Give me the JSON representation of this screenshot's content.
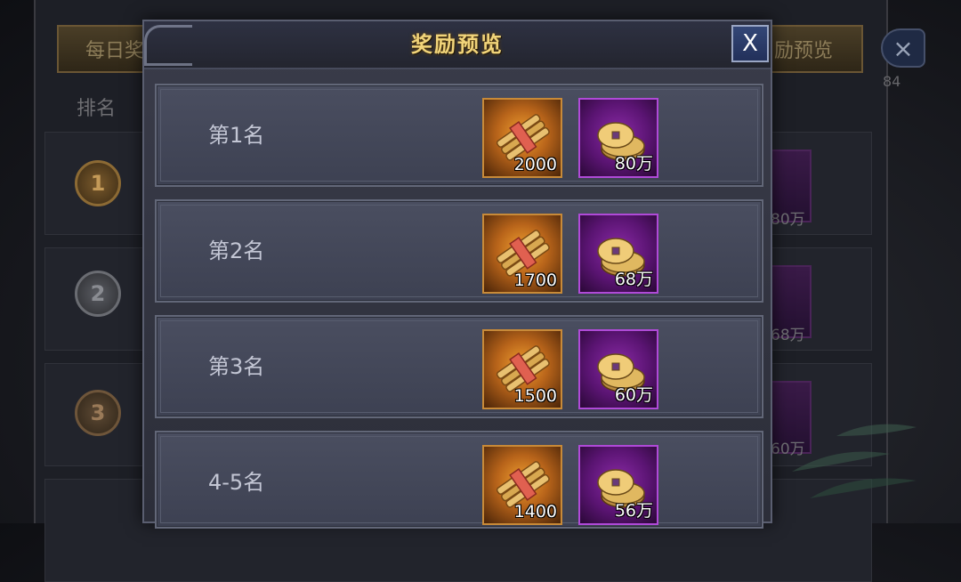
{
  "background": {
    "tab_left_label": "每日奖",
    "tab_right_label": "励预览",
    "close_glyph": "×",
    "rank_header": "排名",
    "side_number": "84",
    "row_coin_labels": [
      "80万",
      "68万",
      "60万"
    ],
    "medals": [
      "1",
      "2",
      "3"
    ]
  },
  "modal": {
    "title": "奖励预览",
    "close_label": "X",
    "rows": [
      {
        "rank": "第1名",
        "scroll_qty": "2000",
        "coin_qty": "80万"
      },
      {
        "rank": "第2名",
        "scroll_qty": "1700",
        "coin_qty": "68万"
      },
      {
        "rank": "第3名",
        "scroll_qty": "1500",
        "coin_qty": "60万"
      },
      {
        "rank": "4-5名",
        "scroll_qty": "1400",
        "coin_qty": "56万"
      }
    ]
  },
  "icons": {
    "scroll_item": "scroll-bundle-icon",
    "coin_item": "copper-coins-icon"
  },
  "colors": {
    "title_gold": "#f1d47a",
    "orange_frame": "#c88a38",
    "purple_frame": "#b04ad8",
    "close_blue": "#2b3b68"
  }
}
